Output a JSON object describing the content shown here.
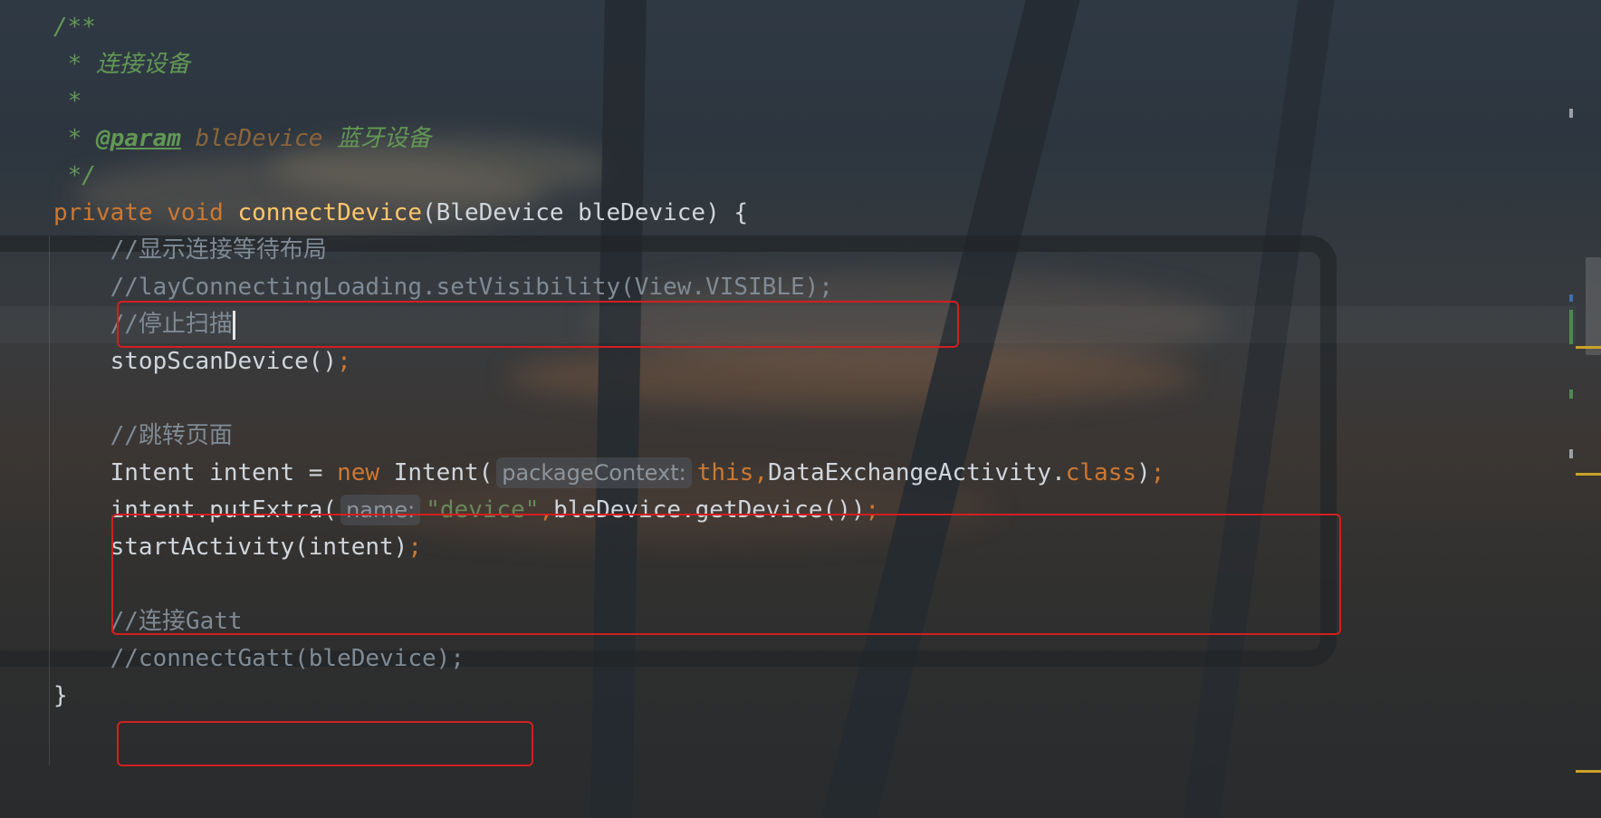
{
  "editor": {
    "lines": [
      {
        "tokens": [
          {
            "t": "/**",
            "c": "doc"
          }
        ]
      },
      {
        "tokens": [
          {
            "t": " * 连接设备",
            "c": "doc"
          }
        ]
      },
      {
        "tokens": [
          {
            "t": " *",
            "c": "doc"
          }
        ]
      },
      {
        "tokens": [
          {
            "t": " * ",
            "c": "doc"
          },
          {
            "t": "@param",
            "c": "doctag"
          },
          {
            "t": " bleDevice",
            "c": "docparam"
          },
          {
            "t": " 蓝牙设备",
            "c": "doc"
          }
        ]
      },
      {
        "tokens": [
          {
            "t": " */",
            "c": "doc"
          }
        ]
      },
      {
        "tokens": [
          {
            "t": "private void ",
            "c": "kw"
          },
          {
            "t": "connectDevice",
            "c": "fn"
          },
          {
            "t": "(BleDevice bleDevice) {",
            "c": "plain"
          }
        ]
      },
      {
        "tokens": [
          {
            "t": "    //显示连接等待布局",
            "c": "comment"
          }
        ]
      },
      {
        "tokens": [
          {
            "t": "    //layConnectingLoading.setVisibility(View.VISIBLE);",
            "c": "comment"
          }
        ]
      },
      {
        "tokens": [
          {
            "t": "    //停止扫描",
            "c": "comment"
          },
          {
            "t": "",
            "c": "caret"
          }
        ]
      },
      {
        "tokens": [
          {
            "t": "    stopScanDevice()",
            "c": "plain"
          },
          {
            "t": ";",
            "c": "kw"
          }
        ]
      },
      {
        "tokens": [
          {
            "t": "",
            "c": "plain"
          }
        ]
      },
      {
        "tokens": [
          {
            "t": "    //跳转页面",
            "c": "comment"
          }
        ]
      },
      {
        "tokens": [
          {
            "t": "    Intent intent = ",
            "c": "plain"
          },
          {
            "t": "new ",
            "c": "kw"
          },
          {
            "t": "Intent(",
            "c": "plain"
          },
          {
            "t": "packageContext:",
            "c": "hint"
          },
          {
            "t": "this,",
            "c": "kw"
          },
          {
            "t": "DataExchangeActivity.",
            "c": "plain"
          },
          {
            "t": "class",
            "c": "kw"
          },
          {
            "t": ")",
            "c": "plain"
          },
          {
            "t": ";",
            "c": "kw"
          }
        ]
      },
      {
        "tokens": [
          {
            "t": "    intent.putExtra(",
            "c": "plain"
          },
          {
            "t": "name:",
            "c": "hint"
          },
          {
            "t": "\"device\"",
            "c": "str"
          },
          {
            "t": ",",
            "c": "kw"
          },
          {
            "t": "bleDevice.getDevice())",
            "c": "plain"
          },
          {
            "t": ";",
            "c": "kw"
          }
        ]
      },
      {
        "tokens": [
          {
            "t": "    startActivity(intent)",
            "c": "plain"
          },
          {
            "t": ";",
            "c": "kw"
          }
        ]
      },
      {
        "tokens": [
          {
            "t": "",
            "c": "plain"
          }
        ]
      },
      {
        "tokens": [
          {
            "t": "    //连接Gatt",
            "c": "comment"
          }
        ]
      },
      {
        "tokens": [
          {
            "t": "    //connectGatt(bleDevice);",
            "c": "comment"
          }
        ]
      },
      {
        "tokens": [
          {
            "t": "}",
            "c": "plain"
          }
        ]
      }
    ]
  },
  "colors": {
    "keyword": "#cc7832",
    "function": "#ffc66d",
    "string": "#6a8759",
    "doc_comment": "#629755",
    "line_comment": "#7f8a94",
    "highlight_box": "#d21f1f"
  }
}
